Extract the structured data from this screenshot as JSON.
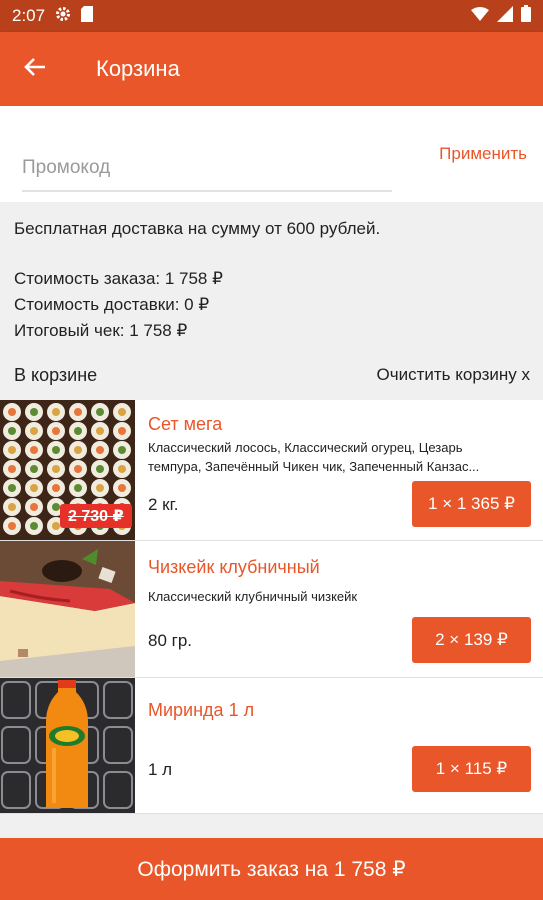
{
  "status_bar": {
    "time": "2:07"
  },
  "app_bar": {
    "title": "Корзина"
  },
  "promo": {
    "placeholder": "Промокод",
    "value": "",
    "apply_label": "Применить"
  },
  "info": {
    "free_delivery": "Бесплатная доставка на сумму от 600 рублей.",
    "order_cost": "Стоимость заказа: 1 758 ₽",
    "delivery_cost": "Стоимость доставки: 0 ₽",
    "total": "Итоговый чек: 1 758 ₽"
  },
  "cart": {
    "title": "В корзине",
    "clear_label": "Очистить корзину x",
    "items": [
      {
        "name": "Сет мега",
        "description_line1": "Классический лосось, Классический огурец, Цезарь",
        "description_line2": "темпура, Запечённый Чикен чик, Запеченный Канзас...",
        "weight": "2 кг.",
        "price": "1 × 1 365 ₽",
        "old_price": "2 730 ₽"
      },
      {
        "name": "Чизкейк клубничный",
        "description_line1": "Классический клубничный чизкейк",
        "weight": "80 гр.",
        "price": "2 × 139 ₽"
      },
      {
        "name": "Миринда 1 л",
        "weight": "1 л",
        "price": "1 × 115 ₽"
      }
    ]
  },
  "checkout": {
    "label": "Оформить заказ на 1 758 ₽"
  },
  "colors": {
    "accent": "#e8562a",
    "status_bar": "#b8401a",
    "discount_badge": "#e53128"
  }
}
